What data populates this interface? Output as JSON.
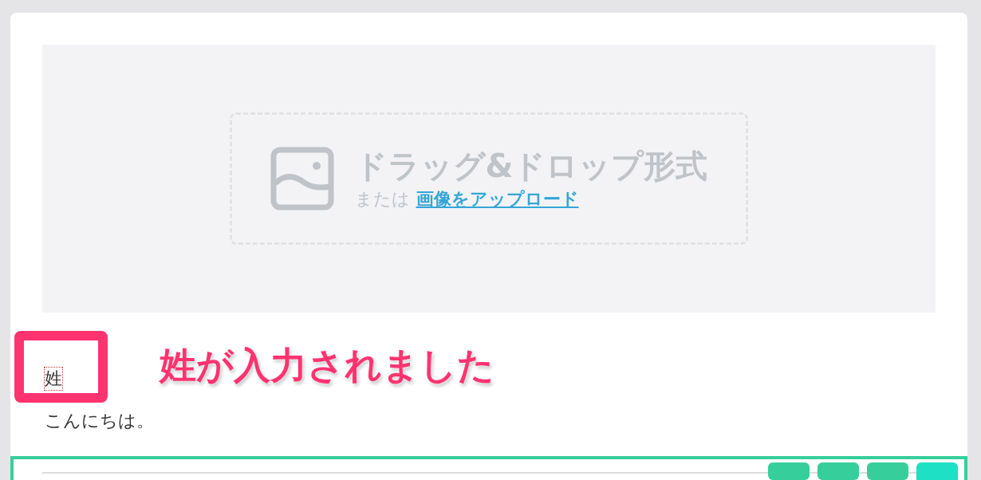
{
  "upload": {
    "title": "ドラッグ&ドロップ形式",
    "or_text": "または",
    "link": "画像をアップロード"
  },
  "name_field": {
    "value": "姓"
  },
  "annotation": {
    "text": "姓が入力されました"
  },
  "paragraph": "こんにちは。",
  "block_toolbar": [
    {
      "selected": false
    },
    {
      "selected": false
    },
    {
      "selected": false
    },
    {
      "selected": true
    }
  ]
}
